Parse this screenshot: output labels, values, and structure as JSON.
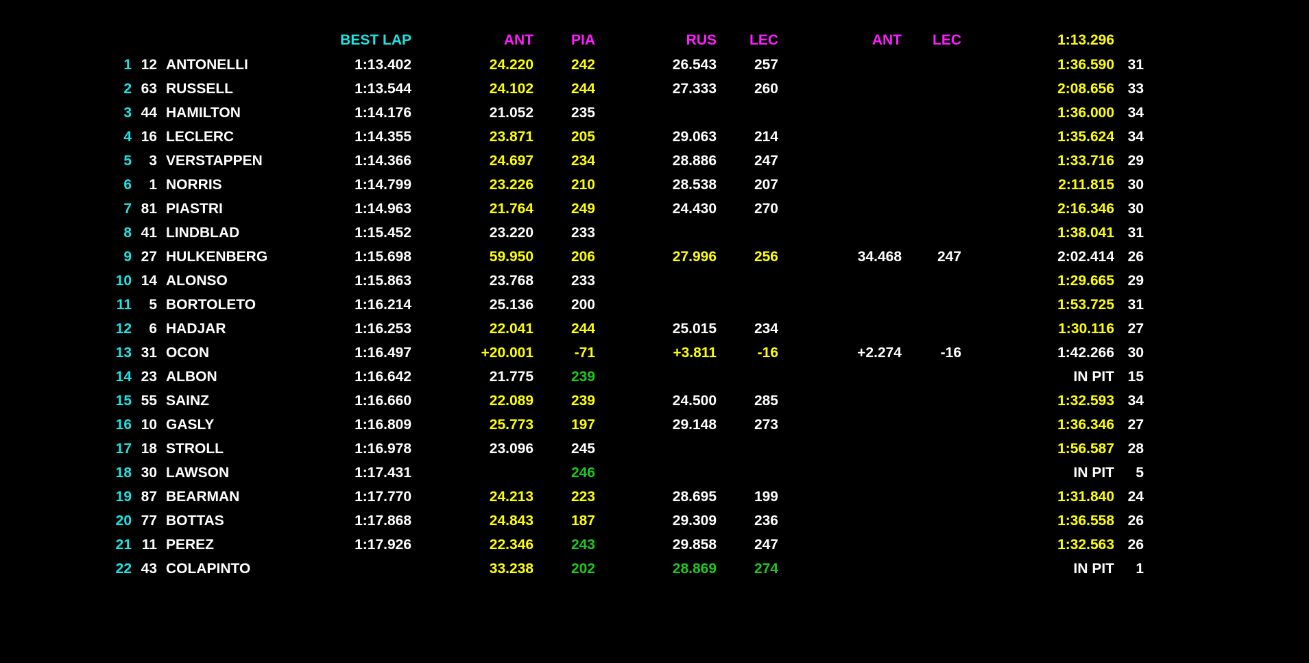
{
  "colors": {
    "background": "#000000",
    "white": "#ffffff",
    "yellow": "#ffff00",
    "green": "#1ec81e",
    "cyan": "#19e6e6",
    "magenta": "#ff1eff"
  },
  "header": {
    "best_lap": "BEST LAP",
    "s1_driver_a": "ANT",
    "s1_driver_b": "PIA",
    "s2_driver_a": "RUS",
    "s2_driver_b": "LEC",
    "s3_driver_a": "ANT",
    "s3_driver_b": "LEC",
    "last_lap_ref": "1:13.296"
  },
  "rows": [
    {
      "pos": "1",
      "num": "12",
      "name": "ANTONELLI",
      "best": "1:13.402",
      "s1a": {
        "v": "24.220",
        "c": "yellow"
      },
      "s1b": {
        "v": "242",
        "c": "yellow"
      },
      "s2a": {
        "v": "26.543",
        "c": "white"
      },
      "s2b": {
        "v": "257",
        "c": "white"
      },
      "s3a": {
        "v": "",
        "c": "white"
      },
      "s3b": {
        "v": "",
        "c": "white"
      },
      "lap": {
        "v": "1:36.590",
        "c": "yellow"
      },
      "laps": "31"
    },
    {
      "pos": "2",
      "num": "63",
      "name": "RUSSELL",
      "best": "1:13.544",
      "s1a": {
        "v": "24.102",
        "c": "yellow"
      },
      "s1b": {
        "v": "244",
        "c": "yellow"
      },
      "s2a": {
        "v": "27.333",
        "c": "white"
      },
      "s2b": {
        "v": "260",
        "c": "white"
      },
      "s3a": {
        "v": "",
        "c": "white"
      },
      "s3b": {
        "v": "",
        "c": "white"
      },
      "lap": {
        "v": "2:08.656",
        "c": "yellow"
      },
      "laps": "33"
    },
    {
      "pos": "3",
      "num": "44",
      "name": "HAMILTON",
      "best": "1:14.176",
      "s1a": {
        "v": "21.052",
        "c": "white"
      },
      "s1b": {
        "v": "235",
        "c": "white"
      },
      "s2a": {
        "v": "",
        "c": "white"
      },
      "s2b": {
        "v": "",
        "c": "white"
      },
      "s3a": {
        "v": "",
        "c": "white"
      },
      "s3b": {
        "v": "",
        "c": "white"
      },
      "lap": {
        "v": "1:36.000",
        "c": "yellow"
      },
      "laps": "34"
    },
    {
      "pos": "4",
      "num": "16",
      "name": "LECLERC",
      "best": "1:14.355",
      "s1a": {
        "v": "23.871",
        "c": "yellow"
      },
      "s1b": {
        "v": "205",
        "c": "yellow"
      },
      "s2a": {
        "v": "29.063",
        "c": "white"
      },
      "s2b": {
        "v": "214",
        "c": "white"
      },
      "s3a": {
        "v": "",
        "c": "white"
      },
      "s3b": {
        "v": "",
        "c": "white"
      },
      "lap": {
        "v": "1:35.624",
        "c": "yellow"
      },
      "laps": "34"
    },
    {
      "pos": "5",
      "num": "3",
      "name": "VERSTAPPEN",
      "best": "1:14.366",
      "s1a": {
        "v": "24.697",
        "c": "yellow"
      },
      "s1b": {
        "v": "234",
        "c": "yellow"
      },
      "s2a": {
        "v": "28.886",
        "c": "white"
      },
      "s2b": {
        "v": "247",
        "c": "white"
      },
      "s3a": {
        "v": "",
        "c": "white"
      },
      "s3b": {
        "v": "",
        "c": "white"
      },
      "lap": {
        "v": "1:33.716",
        "c": "yellow"
      },
      "laps": "29"
    },
    {
      "pos": "6",
      "num": "1",
      "name": "NORRIS",
      "best": "1:14.799",
      "s1a": {
        "v": "23.226",
        "c": "yellow"
      },
      "s1b": {
        "v": "210",
        "c": "yellow"
      },
      "s2a": {
        "v": "28.538",
        "c": "white"
      },
      "s2b": {
        "v": "207",
        "c": "white"
      },
      "s3a": {
        "v": "",
        "c": "white"
      },
      "s3b": {
        "v": "",
        "c": "white"
      },
      "lap": {
        "v": "2:11.815",
        "c": "yellow"
      },
      "laps": "30"
    },
    {
      "pos": "7",
      "num": "81",
      "name": "PIASTRI",
      "best": "1:14.963",
      "s1a": {
        "v": "21.764",
        "c": "yellow"
      },
      "s1b": {
        "v": "249",
        "c": "yellow"
      },
      "s2a": {
        "v": "24.430",
        "c": "white"
      },
      "s2b": {
        "v": "270",
        "c": "white"
      },
      "s3a": {
        "v": "",
        "c": "white"
      },
      "s3b": {
        "v": "",
        "c": "white"
      },
      "lap": {
        "v": "2:16.346",
        "c": "yellow"
      },
      "laps": "30"
    },
    {
      "pos": "8",
      "num": "41",
      "name": "LINDBLAD",
      "best": "1:15.452",
      "s1a": {
        "v": "23.220",
        "c": "white"
      },
      "s1b": {
        "v": "233",
        "c": "white"
      },
      "s2a": {
        "v": "",
        "c": "white"
      },
      "s2b": {
        "v": "",
        "c": "white"
      },
      "s3a": {
        "v": "",
        "c": "white"
      },
      "s3b": {
        "v": "",
        "c": "white"
      },
      "lap": {
        "v": "1:38.041",
        "c": "yellow"
      },
      "laps": "31"
    },
    {
      "pos": "9",
      "num": "27",
      "name": "HULKENBERG",
      "best": "1:15.698",
      "s1a": {
        "v": "59.950",
        "c": "yellow"
      },
      "s1b": {
        "v": "206",
        "c": "yellow"
      },
      "s2a": {
        "v": "27.996",
        "c": "yellow"
      },
      "s2b": {
        "v": "256",
        "c": "yellow"
      },
      "s3a": {
        "v": "34.468",
        "c": "white"
      },
      "s3b": {
        "v": "247",
        "c": "white"
      },
      "lap": {
        "v": "2:02.414",
        "c": "white"
      },
      "laps": "26"
    },
    {
      "pos": "10",
      "num": "14",
      "name": "ALONSO",
      "best": "1:15.863",
      "s1a": {
        "v": "23.768",
        "c": "white"
      },
      "s1b": {
        "v": "233",
        "c": "white"
      },
      "s2a": {
        "v": "",
        "c": "white"
      },
      "s2b": {
        "v": "",
        "c": "white"
      },
      "s3a": {
        "v": "",
        "c": "white"
      },
      "s3b": {
        "v": "",
        "c": "white"
      },
      "lap": {
        "v": "1:29.665",
        "c": "yellow"
      },
      "laps": "29"
    },
    {
      "pos": "11",
      "num": "5",
      "name": "BORTOLETO",
      "best": "1:16.214",
      "s1a": {
        "v": "25.136",
        "c": "white"
      },
      "s1b": {
        "v": "200",
        "c": "white"
      },
      "s2a": {
        "v": "",
        "c": "white"
      },
      "s2b": {
        "v": "",
        "c": "white"
      },
      "s3a": {
        "v": "",
        "c": "white"
      },
      "s3b": {
        "v": "",
        "c": "white"
      },
      "lap": {
        "v": "1:53.725",
        "c": "yellow"
      },
      "laps": "31"
    },
    {
      "pos": "12",
      "num": "6",
      "name": "HADJAR",
      "best": "1:16.253",
      "s1a": {
        "v": "22.041",
        "c": "yellow"
      },
      "s1b": {
        "v": "244",
        "c": "yellow"
      },
      "s2a": {
        "v": "25.015",
        "c": "white"
      },
      "s2b": {
        "v": "234",
        "c": "white"
      },
      "s3a": {
        "v": "",
        "c": "white"
      },
      "s3b": {
        "v": "",
        "c": "white"
      },
      "lap": {
        "v": "1:30.116",
        "c": "yellow"
      },
      "laps": "27"
    },
    {
      "pos": "13",
      "num": "31",
      "name": "OCON",
      "best": "1:16.497",
      "s1a": {
        "v": "+20.001",
        "c": "yellow"
      },
      "s1b": {
        "v": "-71",
        "c": "yellow"
      },
      "s2a": {
        "v": "+3.811",
        "c": "yellow"
      },
      "s2b": {
        "v": "-16",
        "c": "yellow"
      },
      "s3a": {
        "v": "+2.274",
        "c": "white"
      },
      "s3b": {
        "v": "-16",
        "c": "white"
      },
      "lap": {
        "v": "1:42.266",
        "c": "white"
      },
      "laps": "30"
    },
    {
      "pos": "14",
      "num": "23",
      "name": "ALBON",
      "best": "1:16.642",
      "s1a": {
        "v": "21.775",
        "c": "white"
      },
      "s1b": {
        "v": "239",
        "c": "green"
      },
      "s2a": {
        "v": "",
        "c": "white"
      },
      "s2b": {
        "v": "",
        "c": "white"
      },
      "s3a": {
        "v": "",
        "c": "white"
      },
      "s3b": {
        "v": "",
        "c": "white"
      },
      "lap": {
        "v": "IN PIT",
        "c": "white"
      },
      "laps": "15"
    },
    {
      "pos": "15",
      "num": "55",
      "name": "SAINZ",
      "best": "1:16.660",
      "s1a": {
        "v": "22.089",
        "c": "yellow"
      },
      "s1b": {
        "v": "239",
        "c": "yellow"
      },
      "s2a": {
        "v": "24.500",
        "c": "white"
      },
      "s2b": {
        "v": "285",
        "c": "white"
      },
      "s3a": {
        "v": "",
        "c": "white"
      },
      "s3b": {
        "v": "",
        "c": "white"
      },
      "lap": {
        "v": "1:32.593",
        "c": "yellow"
      },
      "laps": "34"
    },
    {
      "pos": "16",
      "num": "10",
      "name": "GASLY",
      "best": "1:16.809",
      "s1a": {
        "v": "25.773",
        "c": "yellow"
      },
      "s1b": {
        "v": "197",
        "c": "yellow"
      },
      "s2a": {
        "v": "29.148",
        "c": "white"
      },
      "s2b": {
        "v": "273",
        "c": "white"
      },
      "s3a": {
        "v": "",
        "c": "white"
      },
      "s3b": {
        "v": "",
        "c": "white"
      },
      "lap": {
        "v": "1:36.346",
        "c": "yellow"
      },
      "laps": "27"
    },
    {
      "pos": "17",
      "num": "18",
      "name": "STROLL",
      "best": "1:16.978",
      "s1a": {
        "v": "23.096",
        "c": "white"
      },
      "s1b": {
        "v": "245",
        "c": "white"
      },
      "s2a": {
        "v": "",
        "c": "white"
      },
      "s2b": {
        "v": "",
        "c": "white"
      },
      "s3a": {
        "v": "",
        "c": "white"
      },
      "s3b": {
        "v": "",
        "c": "white"
      },
      "lap": {
        "v": "1:56.587",
        "c": "yellow"
      },
      "laps": "28"
    },
    {
      "pos": "18",
      "num": "30",
      "name": "LAWSON",
      "best": "1:17.431",
      "s1a": {
        "v": "",
        "c": "white"
      },
      "s1b": {
        "v": "246",
        "c": "green"
      },
      "s2a": {
        "v": "",
        "c": "white"
      },
      "s2b": {
        "v": "",
        "c": "white"
      },
      "s3a": {
        "v": "",
        "c": "white"
      },
      "s3b": {
        "v": "",
        "c": "white"
      },
      "lap": {
        "v": "IN PIT",
        "c": "white"
      },
      "laps": "5"
    },
    {
      "pos": "19",
      "num": "87",
      "name": "BEARMAN",
      "best": "1:17.770",
      "s1a": {
        "v": "24.213",
        "c": "yellow"
      },
      "s1b": {
        "v": "223",
        "c": "yellow"
      },
      "s2a": {
        "v": "28.695",
        "c": "white"
      },
      "s2b": {
        "v": "199",
        "c": "white"
      },
      "s3a": {
        "v": "",
        "c": "white"
      },
      "s3b": {
        "v": "",
        "c": "white"
      },
      "lap": {
        "v": "1:31.840",
        "c": "yellow"
      },
      "laps": "24"
    },
    {
      "pos": "20",
      "num": "77",
      "name": "BOTTAS",
      "best": "1:17.868",
      "s1a": {
        "v": "24.843",
        "c": "yellow"
      },
      "s1b": {
        "v": "187",
        "c": "yellow"
      },
      "s2a": {
        "v": "29.309",
        "c": "white"
      },
      "s2b": {
        "v": "236",
        "c": "white"
      },
      "s3a": {
        "v": "",
        "c": "white"
      },
      "s3b": {
        "v": "",
        "c": "white"
      },
      "lap": {
        "v": "1:36.558",
        "c": "yellow"
      },
      "laps": "26"
    },
    {
      "pos": "21",
      "num": "11",
      "name": "PEREZ",
      "best": "1:17.926",
      "s1a": {
        "v": "22.346",
        "c": "yellow"
      },
      "s1b": {
        "v": "243",
        "c": "green"
      },
      "s2a": {
        "v": "29.858",
        "c": "white"
      },
      "s2b": {
        "v": "247",
        "c": "white"
      },
      "s3a": {
        "v": "",
        "c": "white"
      },
      "s3b": {
        "v": "",
        "c": "white"
      },
      "lap": {
        "v": "1:32.563",
        "c": "yellow"
      },
      "laps": "26"
    },
    {
      "pos": "22",
      "num": "43",
      "name": "COLAPINTO",
      "best": "",
      "s1a": {
        "v": "33.238",
        "c": "yellow"
      },
      "s1b": {
        "v": "202",
        "c": "green"
      },
      "s2a": {
        "v": "28.869",
        "c": "green"
      },
      "s2b": {
        "v": "274",
        "c": "green"
      },
      "s3a": {
        "v": "",
        "c": "white"
      },
      "s3b": {
        "v": "",
        "c": "white"
      },
      "lap": {
        "v": "IN PIT",
        "c": "white"
      },
      "laps": "1"
    }
  ]
}
